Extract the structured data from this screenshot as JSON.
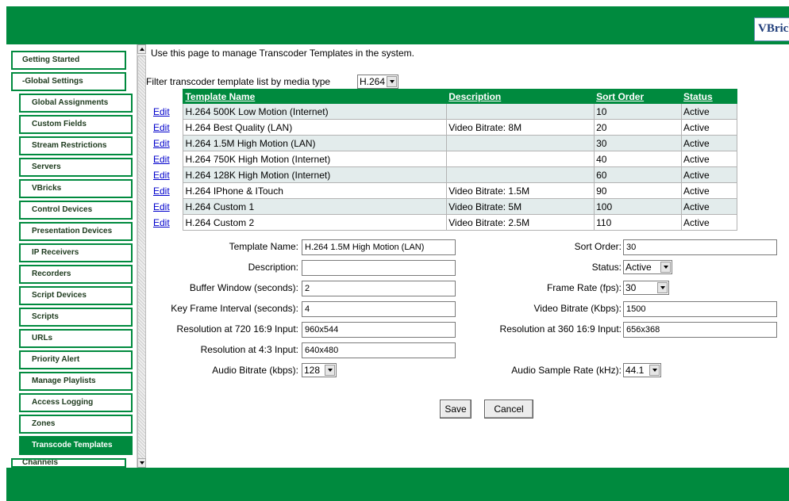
{
  "header": {
    "logo_text": "VBrick"
  },
  "sidebar": {
    "items": [
      {
        "label": "Getting Started",
        "level": "top",
        "active": false
      },
      {
        "label": "-Global Settings",
        "level": "top",
        "active": false
      },
      {
        "label": "Global Assignments",
        "level": "sub",
        "active": false
      },
      {
        "label": "Custom Fields",
        "level": "sub",
        "active": false
      },
      {
        "label": "Stream Restrictions",
        "level": "sub",
        "active": false
      },
      {
        "label": "Servers",
        "level": "sub",
        "active": false
      },
      {
        "label": "VBricks",
        "level": "sub",
        "active": false
      },
      {
        "label": "Control Devices",
        "level": "sub",
        "active": false
      },
      {
        "label": "Presentation Devices",
        "level": "sub",
        "active": false
      },
      {
        "label": "IP Receivers",
        "level": "sub",
        "active": false
      },
      {
        "label": "Recorders",
        "level": "sub",
        "active": false
      },
      {
        "label": "Script Devices",
        "level": "sub",
        "active": false
      },
      {
        "label": "Scripts",
        "level": "sub",
        "active": false
      },
      {
        "label": "URLs",
        "level": "sub",
        "active": false
      },
      {
        "label": "Priority Alert",
        "level": "sub",
        "active": false
      },
      {
        "label": "Manage Playlists",
        "level": "sub",
        "active": false
      },
      {
        "label": "Access Logging",
        "level": "sub",
        "active": false
      },
      {
        "label": "Zones",
        "level": "sub",
        "active": false
      },
      {
        "label": "Transcode Templates",
        "level": "sub",
        "active": true
      },
      {
        "label": "Channels",
        "level": "top",
        "active": false
      }
    ]
  },
  "main": {
    "intro": "Use this page to manage Transcoder Templates in the system.",
    "filter": {
      "label": "Filter transcoder template list by media type",
      "value": "H.264"
    },
    "table": {
      "headers": [
        "Template Name",
        "Description",
        "Sort Order",
        "Status"
      ],
      "edit_label": "Edit",
      "rows": [
        {
          "name": "H.264 500K Low Motion (Internet)",
          "description": "",
          "sort": "10",
          "status": "Active"
        },
        {
          "name": "H.264 Best Quality (LAN)",
          "description": "Video Bitrate: 8M",
          "sort": "20",
          "status": "Active"
        },
        {
          "name": "H.264 1.5M High Motion (LAN)",
          "description": "",
          "sort": "30",
          "status": "Active"
        },
        {
          "name": "H.264 750K High Motion (Internet)",
          "description": "",
          "sort": "40",
          "status": "Active"
        },
        {
          "name": "H.264 128K High Motion (Internet)",
          "description": "",
          "sort": "60",
          "status": "Active"
        },
        {
          "name": "H.264 IPhone & ITouch",
          "description": "Video Bitrate: 1.5M",
          "sort": "90",
          "status": "Active"
        },
        {
          "name": "H.264 Custom 1",
          "description": "Video Bitrate: 5M",
          "sort": "100",
          "status": "Active"
        },
        {
          "name": "H.264 Custom 2",
          "description": "Video Bitrate: 2.5M",
          "sort": "110",
          "status": "Active"
        }
      ]
    },
    "form": {
      "template_name": {
        "label": "Template Name:",
        "value": "H.264 1.5M High Motion (LAN)"
      },
      "sort_order": {
        "label": "Sort Order:",
        "value": "30"
      },
      "description": {
        "label": "Description:",
        "value": ""
      },
      "status": {
        "label": "Status:",
        "value": "Active"
      },
      "buffer_window": {
        "label": "Buffer Window (seconds):",
        "value": "2"
      },
      "frame_rate": {
        "label": "Frame Rate (fps):",
        "value": "30"
      },
      "key_frame": {
        "label": "Key Frame Interval (seconds):",
        "value": "4"
      },
      "video_bitrate": {
        "label": "Video Bitrate (Kbps):",
        "value": "1500"
      },
      "res_720": {
        "label": "Resolution at 720 16:9 Input:",
        "value": "960x544"
      },
      "res_360": {
        "label": "Resolution at 360 16:9 Input:",
        "value": "656x368"
      },
      "res_43": {
        "label": "Resolution at 4:3 Input:",
        "value": "640x480"
      },
      "audio_bitrate": {
        "label": "Audio Bitrate (kbps):",
        "value": "128"
      },
      "audio_sample": {
        "label": "Audio Sample Rate (kHz):",
        "value": "44.1"
      },
      "save_label": "Save",
      "cancel_label": "Cancel"
    }
  },
  "colors": {
    "brand_green": "#008a3e",
    "row_alt": "#e3ecec",
    "link": "#0000cc"
  }
}
